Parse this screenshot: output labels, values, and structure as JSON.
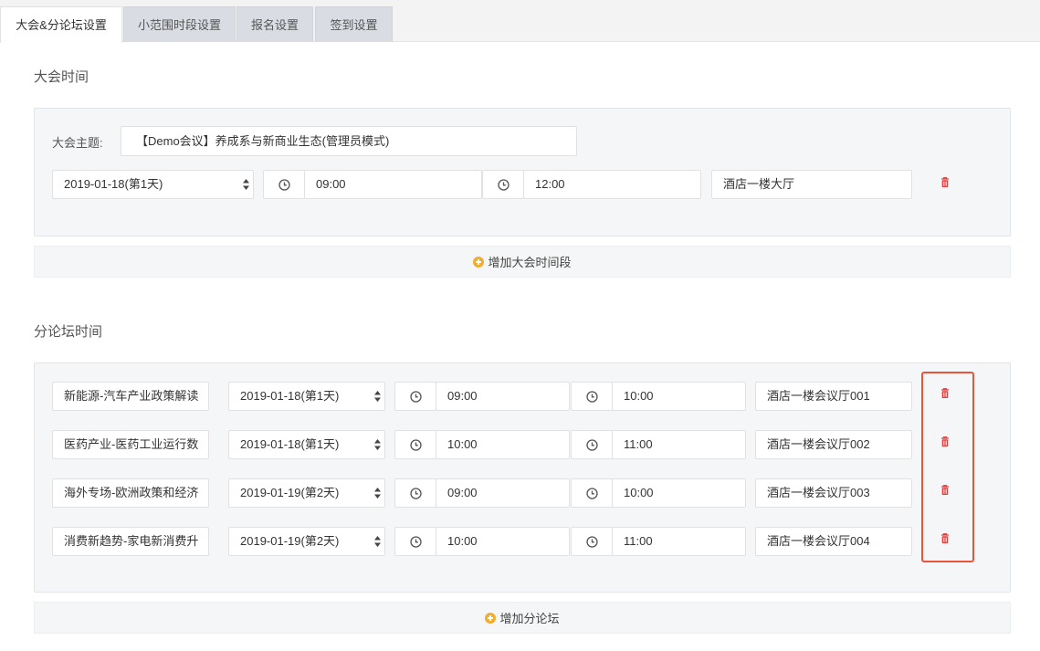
{
  "tabs": [
    {
      "label": "大会&分论坛设置",
      "active": true
    },
    {
      "label": "小范围时段设置",
      "active": false
    },
    {
      "label": "报名设置",
      "active": false
    },
    {
      "label": "签到设置",
      "active": false
    }
  ],
  "conference": {
    "section_title": "大会时间",
    "theme_label": "大会主题:",
    "theme_value": "【Demo会议】养成系与新商业生态(管理员模式)",
    "row": {
      "date": "2019-01-18(第1天)",
      "start": "09:00",
      "end": "12:00",
      "venue": "酒店一楼大厅"
    },
    "add_label": "增加大会时间段"
  },
  "forum": {
    "section_title": "分论坛时间",
    "rows": [
      {
        "name": "新能源-汽车产业政策解读",
        "date": "2019-01-18(第1天)",
        "start": "09:00",
        "end": "10:00",
        "venue": "酒店一楼会议厅001"
      },
      {
        "name": "医药产业-医药工业运行数",
        "date": "2019-01-18(第1天)",
        "start": "10:00",
        "end": "11:00",
        "venue": "酒店一楼会议厅002"
      },
      {
        "name": "海外专场-欧洲政策和经济",
        "date": "2019-01-19(第2天)",
        "start": "09:00",
        "end": "10:00",
        "venue": "酒店一楼会议厅003"
      },
      {
        "name": "消费新趋势-家电新消费升",
        "date": "2019-01-19(第2天)",
        "start": "10:00",
        "end": "11:00",
        "venue": "酒店一楼会议厅004"
      }
    ],
    "add_label": "增加分论坛"
  },
  "icons": {
    "clock": "clock-icon",
    "trash": "trash-icon",
    "add": "plus-circle-icon"
  },
  "colors": {
    "accent_add": "#f0ad2e",
    "delete_red": "#e23c3c",
    "highlight": "#e8553b"
  }
}
